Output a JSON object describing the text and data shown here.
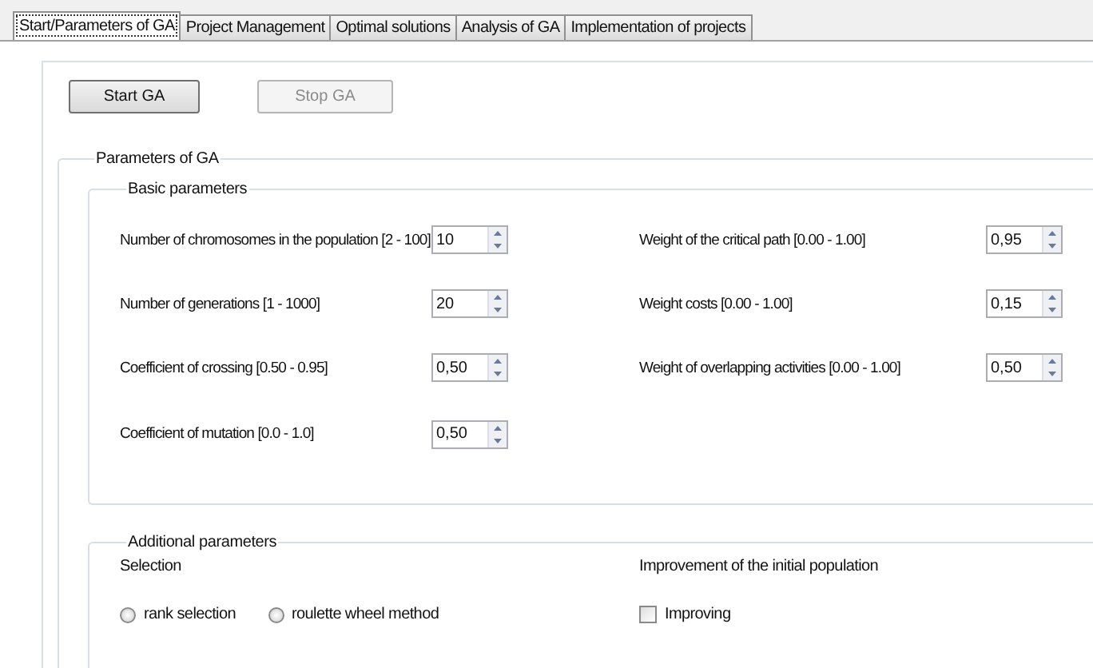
{
  "tabs": [
    {
      "label": "Start/Parameters of GA",
      "selected": true
    },
    {
      "label": "Project Management",
      "selected": false
    },
    {
      "label": "Optimal solutions",
      "selected": false
    },
    {
      "label": "Analysis of GA",
      "selected": false
    },
    {
      "label": "Implementation of projects",
      "selected": false
    }
  ],
  "buttons": [
    {
      "label": "Start GA",
      "disabled": false
    },
    {
      "label": "Stop GA",
      "disabled": true
    }
  ],
  "parameters": {
    "title": "Parameters of GA",
    "basic": {
      "title": "Basic parameters",
      "left": [
        {
          "label": "Number of chromosomes in the population [2 - 100]",
          "value": "10"
        },
        {
          "label": "Number of generations [1 - 1000]",
          "value": "20"
        },
        {
          "label": "Coefficient of crossing [0.50 - 0.95]",
          "value": "0,50"
        },
        {
          "label": "Coefficient of mutation [0.0 - 1.0]",
          "value": "0,50"
        }
      ],
      "right": [
        {
          "label": "Weight of the critical path [0.00 - 1.00]",
          "value": "0,95"
        },
        {
          "label": "Weight costs [0.00 - 1.00]",
          "value": "0,15"
        },
        {
          "label": "Weight of overlapping activities [0.00 - 1.00]",
          "value": "0,50"
        }
      ]
    },
    "additional": {
      "title": "Additional parameters",
      "selection": {
        "title": "Selection",
        "options": [
          {
            "label": "rank selection",
            "selected": false
          },
          {
            "label": "roulette wheel method",
            "selected": false
          }
        ]
      },
      "improvement": {
        "title": "Improvement of the initial population",
        "checkbox": {
          "label": "Improving",
          "checked": false
        }
      }
    }
  }
}
